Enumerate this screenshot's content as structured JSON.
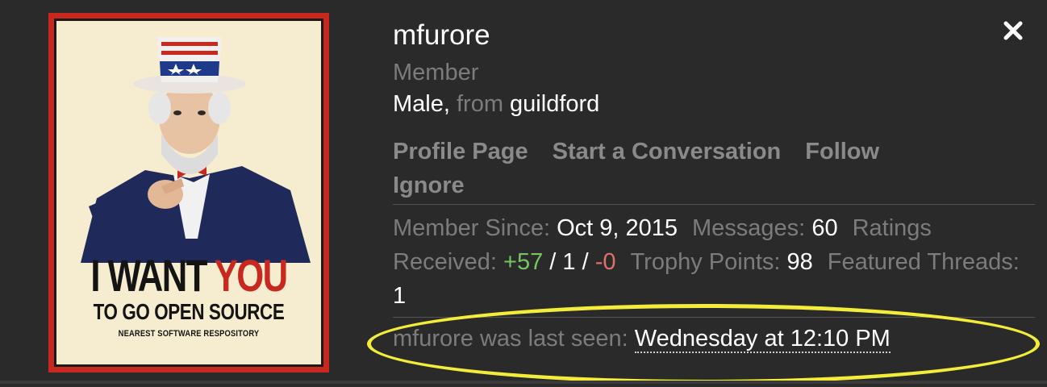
{
  "poster": {
    "line1_a": "I WANT ",
    "line1_b": "YOU",
    "line2": "TO GO OPEN SOURCE",
    "line3": "NEAREST SOFTWARE RESPOSITORY"
  },
  "profile": {
    "username": "mfurore",
    "title": "Member",
    "gender": "Male,",
    "from_label": "from",
    "location": "guildford"
  },
  "links": {
    "profile_page": "Profile Page",
    "start_conversation": "Start a Conversation",
    "follow": "Follow",
    "ignore": "Ignore"
  },
  "stats": {
    "member_since_label": "Member Since:",
    "member_since_value": "Oct 9, 2015",
    "messages_label": "Messages:",
    "messages_value": "60",
    "ratings_label": "Ratings Received:",
    "ratings_positive": "+57",
    "ratings_sep1": "/",
    "ratings_neutral": "1",
    "ratings_sep2": "/",
    "ratings_negative": "-0",
    "trophy_label": "Trophy Points:",
    "trophy_value": "98",
    "featured_label": "Featured Threads:",
    "featured_value": "1"
  },
  "last_seen": {
    "label": "mfurore was last seen:",
    "value": "Wednesday at 12:10 PM"
  },
  "colors": {
    "background": "#2a2a2a",
    "muted_text": "#7c7c7c",
    "positive": "#77c560",
    "negative": "#e0706a",
    "highlight": "#f4ec3a",
    "poster_red": "#c8281e"
  },
  "icons": {
    "close": "close-icon"
  }
}
